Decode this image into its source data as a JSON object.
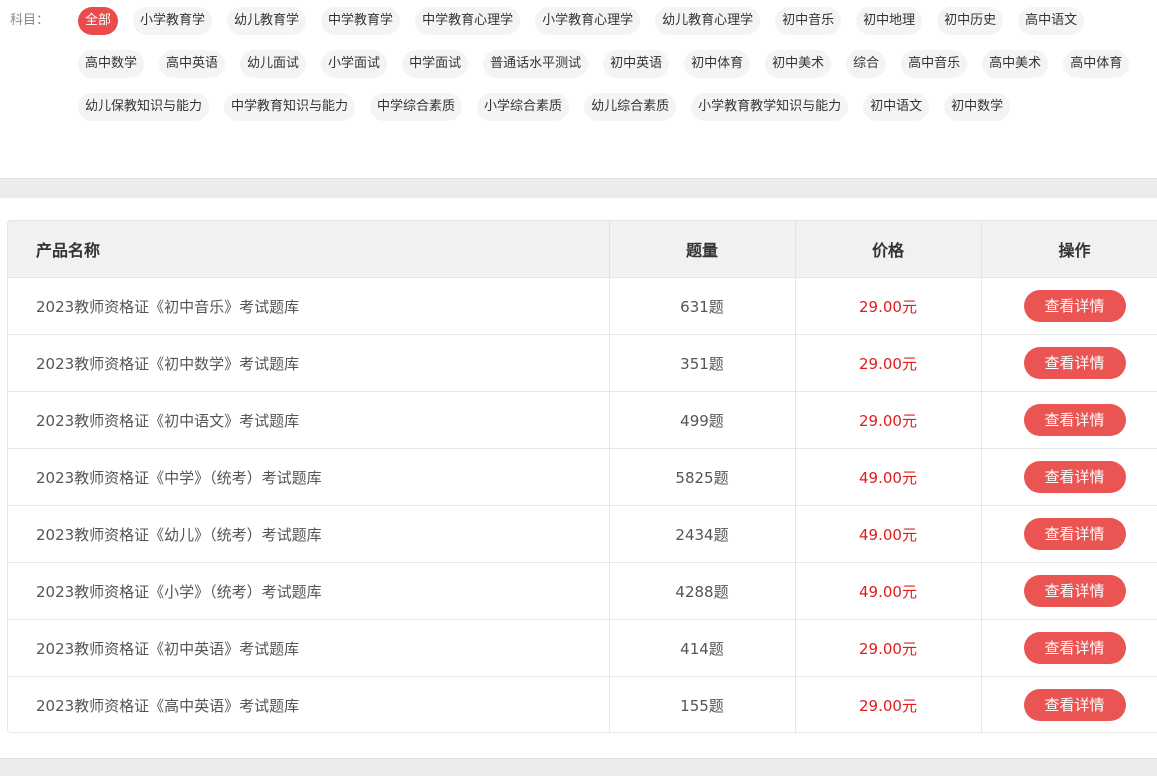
{
  "filter": {
    "label": "科目：",
    "subjects": [
      {
        "label": "全部",
        "active": true
      },
      {
        "label": "小学教育学"
      },
      {
        "label": "幼儿教育学"
      },
      {
        "label": "中学教育学"
      },
      {
        "label": "中学教育心理学"
      },
      {
        "label": "小学教育心理学"
      },
      {
        "label": "幼儿教育心理学"
      },
      {
        "label": "初中音乐"
      },
      {
        "label": "初中地理"
      },
      {
        "label": "初中历史"
      },
      {
        "label": "高中语文"
      },
      {
        "label": "高中数学"
      },
      {
        "label": "高中英语"
      },
      {
        "label": "幼儿面试"
      },
      {
        "label": "小学面试"
      },
      {
        "label": "中学面试"
      },
      {
        "label": "普通话水平测试"
      },
      {
        "label": "初中英语"
      },
      {
        "label": "初中体育"
      },
      {
        "label": "初中美术"
      },
      {
        "label": "综合"
      },
      {
        "label": "高中音乐"
      },
      {
        "label": "高中美术"
      },
      {
        "label": "高中体育"
      },
      {
        "label": "幼儿保教知识与能力"
      },
      {
        "label": "中学教育知识与能力"
      },
      {
        "label": "中学综合素质"
      },
      {
        "label": "小学综合素质"
      },
      {
        "label": "幼儿综合素质"
      },
      {
        "label": "小学教育教学知识与能力"
      },
      {
        "label": "初中语文"
      },
      {
        "label": "初中数学"
      }
    ],
    "active_color": "#ea4b4b"
  },
  "table": {
    "headers": {
      "name": "产品名称",
      "count": "题量",
      "price": "价格",
      "action": "操作"
    },
    "rows": [
      {
        "name": "2023教师资格证《初中音乐》考试题库",
        "count": "631题",
        "price": "29.00元",
        "action": "查看详情"
      },
      {
        "name": "2023教师资格证《初中数学》考试题库",
        "count": "351题",
        "price": "29.00元",
        "action": "查看详情"
      },
      {
        "name": "2023教师资格证《初中语文》考试题库",
        "count": "499题",
        "price": "29.00元",
        "action": "查看详情"
      },
      {
        "name": "2023教师资格证《中学》（统考）考试题库",
        "count": "5825题",
        "price": "49.00元",
        "action": "查看详情"
      },
      {
        "name": "2023教师资格证《幼儿》（统考）考试题库",
        "count": "2434题",
        "price": "49.00元",
        "action": "查看详情"
      },
      {
        "name": "2023教师资格证《小学》（统考）考试题库",
        "count": "4288题",
        "price": "49.00元",
        "action": "查看详情"
      },
      {
        "name": "2023教师资格证《初中英语》考试题库",
        "count": "414题",
        "price": "29.00元",
        "action": "查看详情"
      },
      {
        "name": "2023教师资格证《高中英语》考试题库",
        "count": "155题",
        "price": "29.00元",
        "action": "查看详情"
      }
    ],
    "price_color": "#e01b1b",
    "button_color": "#ea5553"
  }
}
